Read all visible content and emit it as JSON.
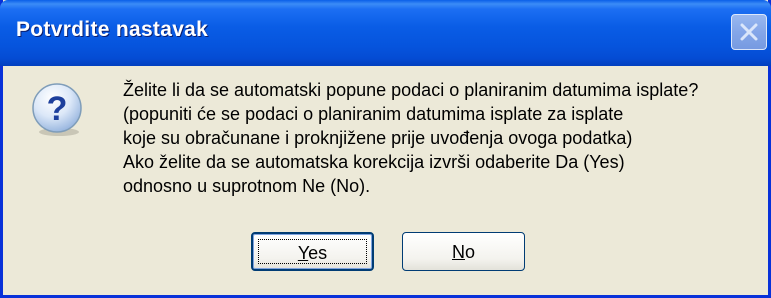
{
  "dialog": {
    "title": "Potvrdite nastavak",
    "message": "Želite li da se automatski popune podaci o planiranim datumima isplate?\n(popuniti će se podaci o planiranim datumima isplate za isplate\nkoje su obračunane i proknjižene prije uvođenja ovoga podatka)\nAko želite da se automatska korekcija izvrši odaberite Da (Yes)\nodnosno u suprotnom Ne (No).",
    "icon": "question-icon",
    "buttons": {
      "yes": {
        "mnemonic": "Y",
        "rest": "es"
      },
      "no": {
        "mnemonic": "N",
        "rest": "o"
      }
    }
  },
  "colors": {
    "titlebar": "#0a5de6",
    "frame": "#0831d9",
    "dialog_bg": "#ece9d8"
  }
}
